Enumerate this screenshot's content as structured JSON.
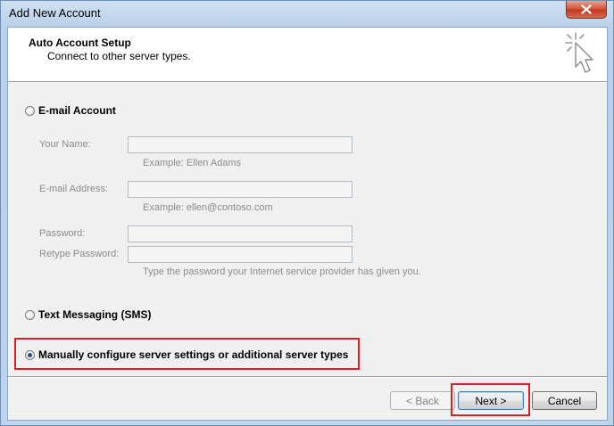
{
  "window": {
    "title": "Add New Account"
  },
  "header": {
    "title": "Auto Account Setup",
    "subtitle": "Connect to other server types."
  },
  "options": {
    "email_account": {
      "label": "E-mail Account",
      "selected": false
    },
    "text_messaging": {
      "label": "Text Messaging (SMS)",
      "selected": false
    },
    "manual_config": {
      "label": "Manually configure server settings or additional server types",
      "selected": true
    }
  },
  "email_form": {
    "your_name": {
      "label": "Your Name:",
      "value": "",
      "hint": "Example: Ellen Adams"
    },
    "email_address": {
      "label": "E-mail Address:",
      "value": "",
      "hint": "Example: ellen@contoso.com"
    },
    "password": {
      "label": "Password:",
      "value": ""
    },
    "retype_password": {
      "label": "Retype Password:",
      "value": "",
      "hint": "Type the password your Internet service provider has given you."
    }
  },
  "buttons": {
    "back": "< Back",
    "next": "Next >",
    "cancel": "Cancel"
  },
  "icons": {
    "close": "close-icon",
    "wizard": "cursor-click-icon"
  },
  "colors": {
    "highlight": "#d8202a",
    "title_bar": "#bed3ec",
    "dialog_bg": "#f0f0f0"
  }
}
